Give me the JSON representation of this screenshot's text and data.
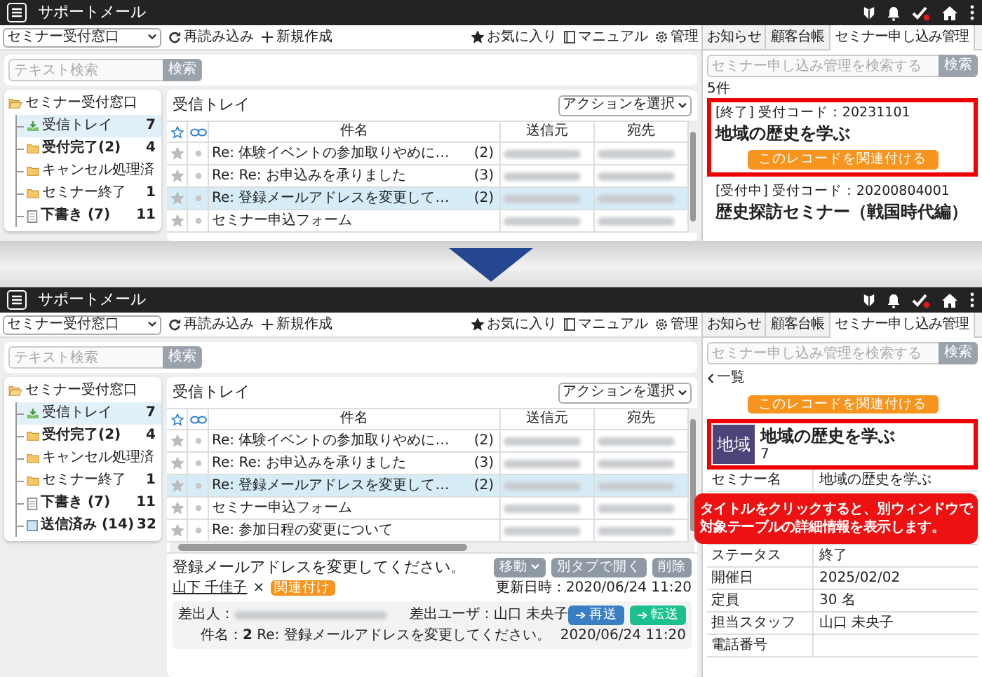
{
  "screens": [
    {
      "app_title": "サポートメール",
      "mailbox_select": "セミナー受付窓口",
      "toolbar": [
        {
          "label": "再読み込み",
          "kind": "reload"
        },
        {
          "label": "新規作成",
          "kind": "new"
        }
      ],
      "top_links": [
        {
          "label": "お気に入り",
          "kind": "favorite"
        },
        {
          "label": "マニュアル",
          "kind": "manual"
        },
        {
          "label": "管理",
          "kind": "admin"
        }
      ],
      "search": {
        "placeholder": "テキスト検索",
        "button": "検索"
      },
      "folder_tree": {
        "label": "セミナー受付窓口",
        "children": [
          {
            "label": "受信トレイ",
            "count": "7",
            "kind": "inbox",
            "unread": false,
            "selected": true
          },
          {
            "label": "受付完了(2)",
            "count": "4",
            "kind": "folder",
            "unread": true,
            "selected": false
          },
          {
            "label": "キャンセル処理済",
            "kind": "folder",
            "unread": false,
            "selected": false
          },
          {
            "label": "セミナー終了",
            "count": "1",
            "kind": "folder",
            "unread": false,
            "selected": false
          },
          {
            "label": "下書き (7)",
            "count": "11",
            "kind": "draft",
            "unread": true,
            "selected": false
          }
        ]
      },
      "mail_list": {
        "title": "受信トレイ",
        "action_select": "アクションを選択",
        "columns": [
          "件名",
          "送信元",
          "宛先"
        ],
        "rows": [
          {
            "subject": "Re: 体験イベントの参加取りやめに…",
            "thread_count": "(2)",
            "selected": false
          },
          {
            "subject": "Re: Re: お申込みを承りました",
            "thread_count": "(3)",
            "selected": false
          },
          {
            "subject": "Re: 登録メールアドレスを変更して…",
            "thread_count": "(2)",
            "selected": true
          },
          {
            "subject": "セミナー申込フォーム",
            "selected": false
          }
        ]
      },
      "side_panel": {
        "tabs": [
          {
            "label": "お知らせ",
            "selected": false
          },
          {
            "label": "顧客台帳",
            "selected": false
          },
          {
            "label": "セミナー申し込み管理",
            "selected": true
          }
        ],
        "search": {
          "placeholder": "セミナー申し込み管理を検索する",
          "button": "検索"
        },
        "result_count": "5件",
        "records": [
          {
            "code_line": "[終了] 受付コード：20231101",
            "title": "地域の歴史を学ぶ",
            "link_button": "このレコードを関連付ける",
            "highlighted": true
          },
          {
            "code_line": "[受付中] 受付コード：20200804001",
            "title": "歴史探訪セミナー（戦国時代編）",
            "highlighted": false
          }
        ]
      }
    },
    {
      "app_title": "サポートメール",
      "mailbox_select": "セミナー受付窓口",
      "toolbar": [
        {
          "label": "再読み込み",
          "kind": "reload"
        },
        {
          "label": "新規作成",
          "kind": "new"
        }
      ],
      "top_links": [
        {
          "label": "お気に入り",
          "kind": "favorite"
        },
        {
          "label": "マニュアル",
          "kind": "manual"
        },
        {
          "label": "管理",
          "kind": "admin"
        }
      ],
      "search": {
        "placeholder": "テキスト検索",
        "button": "検索"
      },
      "folder_tree": {
        "label": "セミナー受付窓口",
        "children": [
          {
            "label": "受信トレイ",
            "count": "7",
            "kind": "inbox",
            "unread": false,
            "selected": true
          },
          {
            "label": "受付完了(2)",
            "count": "4",
            "kind": "folder",
            "unread": true,
            "selected": false
          },
          {
            "label": "キャンセル処理済",
            "kind": "folder",
            "unread": false,
            "selected": false
          },
          {
            "label": "セミナー終了",
            "count": "1",
            "kind": "folder",
            "unread": false,
            "selected": false
          },
          {
            "label": "下書き (7)",
            "count": "11",
            "kind": "draft",
            "unread": true,
            "selected": false
          },
          {
            "label": "送信済み (14)",
            "count": "32",
            "kind": "sent",
            "unread": true,
            "selected": false
          }
        ]
      },
      "mail_list": {
        "title": "受信トレイ",
        "action_select": "アクションを選択",
        "columns": [
          "件名",
          "送信元",
          "宛先"
        ],
        "rows": [
          {
            "subject": "Re: 体験イベントの参加取りやめに…",
            "thread_count": "(2)",
            "selected": false
          },
          {
            "subject": "Re: Re: お申込みを承りました",
            "thread_count": "(3)",
            "selected": false
          },
          {
            "subject": "Re: 登録メールアドレスを変更して…",
            "thread_count": "(2)",
            "selected": true
          },
          {
            "subject": "セミナー申込フォーム",
            "selected": false
          },
          {
            "subject": "Re: 参加日程の変更について",
            "selected": false
          }
        ]
      },
      "preview": {
        "subject": "登録メールアドレスを変更してください。",
        "actions": [
          {
            "label": "移動",
            "kind": "dropdown"
          },
          {
            "label": "別タブで開く",
            "kind": "plain"
          },
          {
            "label": "削除",
            "kind": "plain"
          }
        ],
        "contact": "山下 千佳子",
        "contact_remove": "×",
        "tag": "関連付け",
        "updated": "更新日時：2020/06/24 11:20",
        "from_label": "差出人：",
        "from_user": "差出ユーザ：山口 未央子",
        "send_buttons": [
          {
            "label": "再送",
            "kind": "resend"
          },
          {
            "label": "転送",
            "kind": "forward"
          }
        ],
        "subject_label": "件名：",
        "subject_count": "2",
        "subject_text": "Re: 登録メールアドレスを変更してください。",
        "date": "2020/06/24 11:20"
      },
      "side_panel": {
        "tabs": [
          {
            "label": "お知らせ",
            "selected": false
          },
          {
            "label": "顧客台帳",
            "selected": false
          },
          {
            "label": "セミナー申し込み管理",
            "selected": true
          }
        ],
        "search": {
          "placeholder": "セミナー申し込み管理を検索する",
          "button": "検索"
        },
        "back_link": "一覧",
        "link_button": "このレコードを関連付ける",
        "record": {
          "thumbnail": "地域",
          "title": "地域の歴史を学ぶ",
          "subtitle": "7",
          "highlighted": true
        },
        "fields": [
          {
            "label": "セミナー名",
            "value": "地域の歴史を学ぶ"
          },
          {
            "label": "ステータス",
            "value": "終了"
          },
          {
            "label": "開催日",
            "value": "2025/02/02"
          },
          {
            "label": "定員",
            "value": "30 名"
          },
          {
            "label": "担当スタッフ",
            "value": "山口 未央子"
          },
          {
            "label": "電話番号"
          }
        ],
        "callout": {
          "lines": [
            "タイトルをクリックすると、別ウィンドウで",
            "対象テーブルの詳細情報を表示します。"
          ]
        }
      }
    }
  ]
}
